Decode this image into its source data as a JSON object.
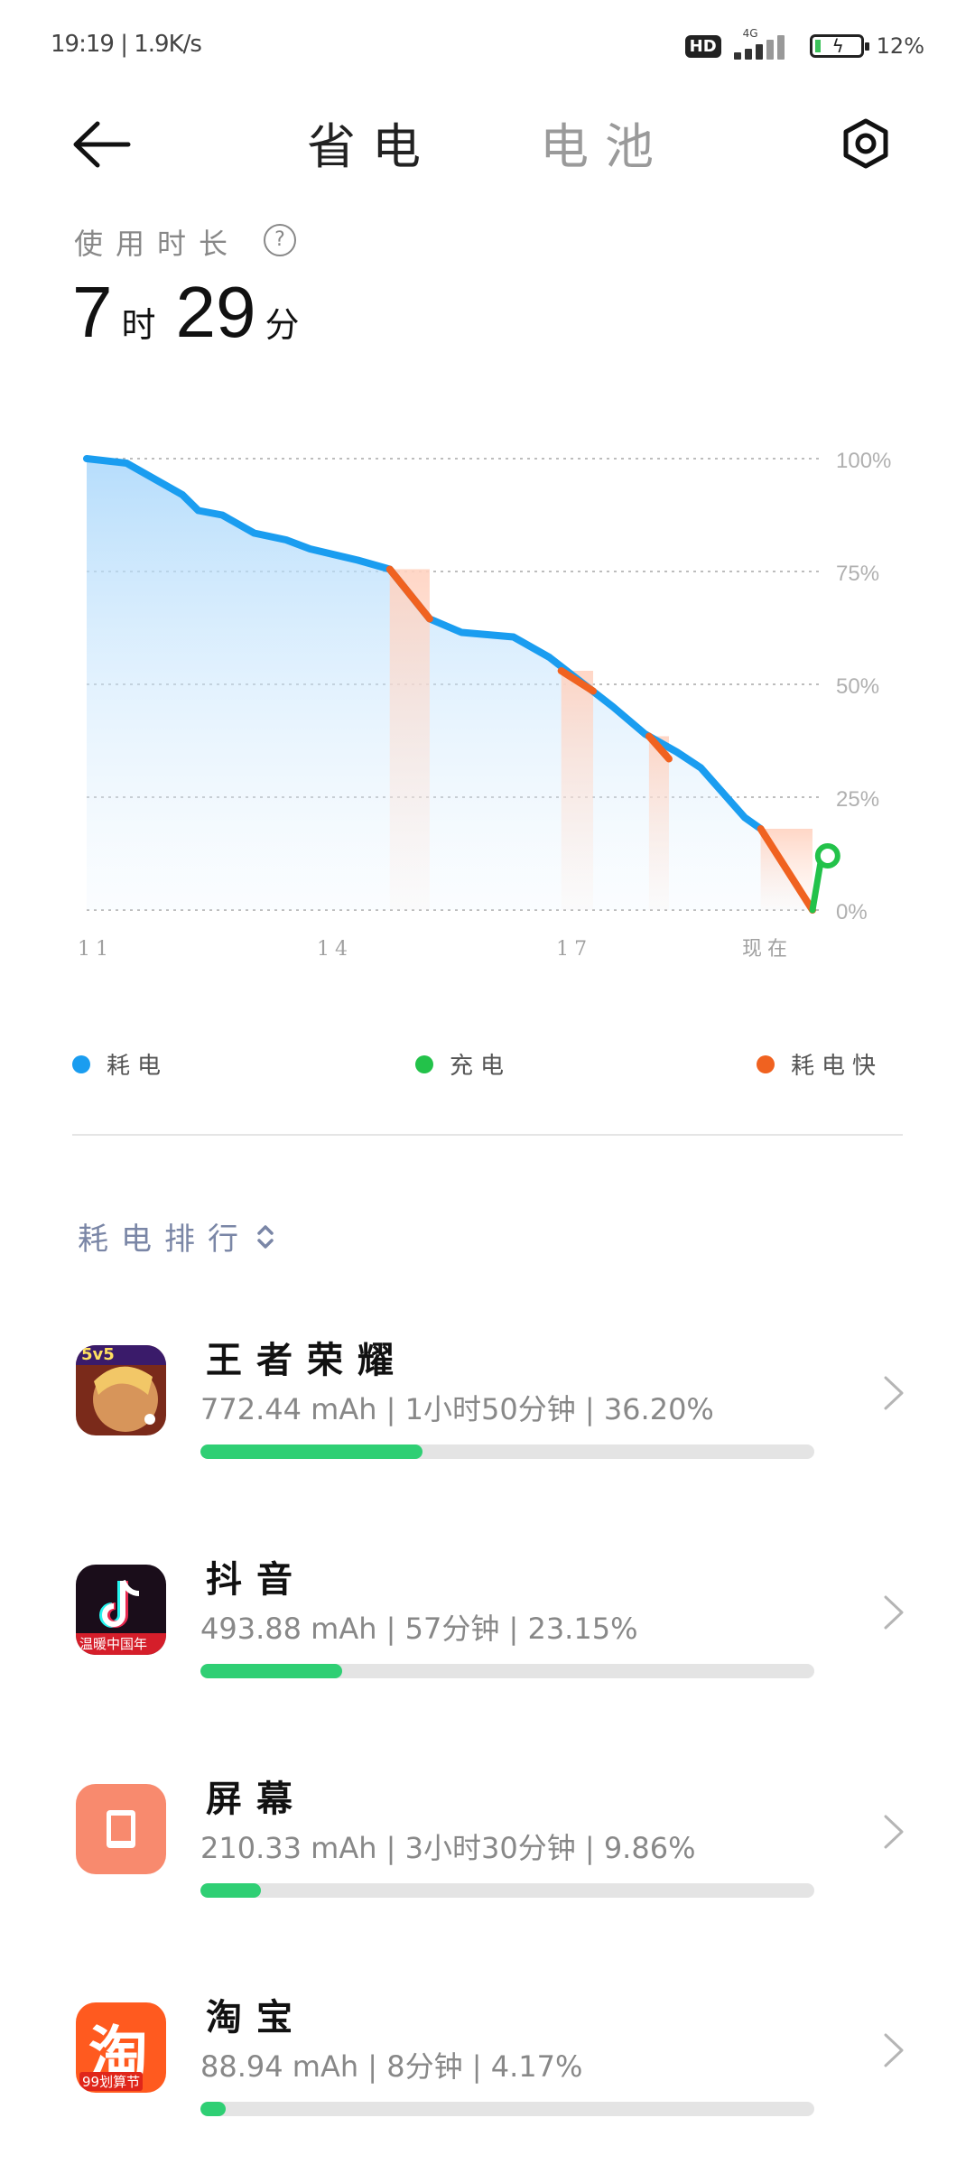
{
  "status_bar": {
    "time_speed": "19:19 | 1.9K/s",
    "hd": "HD",
    "network": "4G",
    "battery_percent": "12%",
    "battery_level": 0.12,
    "charging": true
  },
  "header": {
    "tabs": [
      {
        "label": "省电",
        "active": true
      },
      {
        "label": "电池",
        "active": false
      }
    ],
    "back_icon": "arrow-left-icon",
    "settings_icon": "settings-hexagon-icon"
  },
  "usage": {
    "label": "使用时长",
    "help_icon": "question-circle-icon",
    "hours": "7",
    "hours_unit": "时",
    "minutes": "29",
    "minutes_unit": "分"
  },
  "chart_data": {
    "type": "area",
    "x_ticks": [
      "11",
      "14",
      "17",
      "现在"
    ],
    "x_tick_values": [
      11,
      14,
      17,
      19.33
    ],
    "y_ticks": [
      "100%",
      "75%",
      "50%",
      "25%",
      "0%"
    ],
    "y_tick_values": [
      100,
      75,
      50,
      25,
      0
    ],
    "xlim": [
      11,
      19.33
    ],
    "ylim": [
      0,
      100
    ],
    "grid": true,
    "series": [
      {
        "name": "耗电",
        "color": "#1a9df0",
        "points": [
          [
            11.0,
            100
          ],
          [
            11.5,
            99
          ],
          [
            11.9,
            95
          ],
          [
            12.2,
            92
          ],
          [
            12.4,
            88.5
          ],
          [
            12.7,
            87.5
          ],
          [
            13.1,
            83.5
          ],
          [
            13.5,
            82
          ],
          [
            13.8,
            80
          ],
          [
            14.4,
            77.5
          ],
          [
            14.8,
            75.5
          ],
          [
            15.3,
            64.5
          ],
          [
            15.7,
            61.5
          ],
          [
            16.35,
            60.5
          ],
          [
            16.8,
            56
          ],
          [
            17.2,
            50.5
          ],
          [
            17.6,
            45
          ],
          [
            18.0,
            39
          ],
          [
            18.4,
            35
          ],
          [
            18.7,
            31.5
          ],
          [
            18.95,
            26.5
          ],
          [
            19.05,
            24.5
          ],
          [
            19.25,
            20.5
          ],
          [
            19.45,
            18
          ]
        ]
      },
      {
        "name": "耗电快",
        "color": "#f06220",
        "segments": [
          [
            [
              14.8,
              75.5
            ],
            [
              15.3,
              64.5
            ]
          ],
          [
            [
              16.95,
              53
            ],
            [
              17.35,
              48.5
            ]
          ],
          [
            [
              18.05,
              38.5
            ],
            [
              18.3,
              33.5
            ]
          ],
          [
            [
              19.45,
              18
            ],
            [
              20.1,
              0
            ]
          ]
        ]
      },
      {
        "name": "充电",
        "color": "#23c24a",
        "points": [
          [
            20.1,
            0
          ],
          [
            20.2,
            8
          ]
        ]
      }
    ]
  },
  "legend": [
    {
      "label": "耗电",
      "color": "#1a9df0"
    },
    {
      "label": "充电",
      "color": "#23c24a"
    },
    {
      "label": "耗电快",
      "color": "#f06220"
    }
  ],
  "ranking": {
    "title": "耗电排行",
    "sort_icon": "sort-updown-icon",
    "apps": [
      {
        "name": "王者荣耀",
        "stats": "772.44 mAh | 1小时50分钟 | 36.20%",
        "percent": 36.2,
        "icon": "honor-of-kings-icon",
        "badge": "5v5"
      },
      {
        "name": "抖音",
        "stats": "493.88 mAh | 57分钟 | 23.15%",
        "percent": 23.15,
        "icon": "douyin-icon",
        "badge": "温暖中国年"
      },
      {
        "name": "屏幕",
        "stats": "210.33 mAh | 3小时30分钟 | 9.86%",
        "percent": 9.86,
        "icon": "screen-icon",
        "badge": ""
      },
      {
        "name": "淘宝",
        "stats": "88.94 mAh | 8分钟 | 4.17%",
        "percent": 4.17,
        "icon": "taobao-icon",
        "badge": "99划算节",
        "glyph": "淘"
      }
    ]
  }
}
